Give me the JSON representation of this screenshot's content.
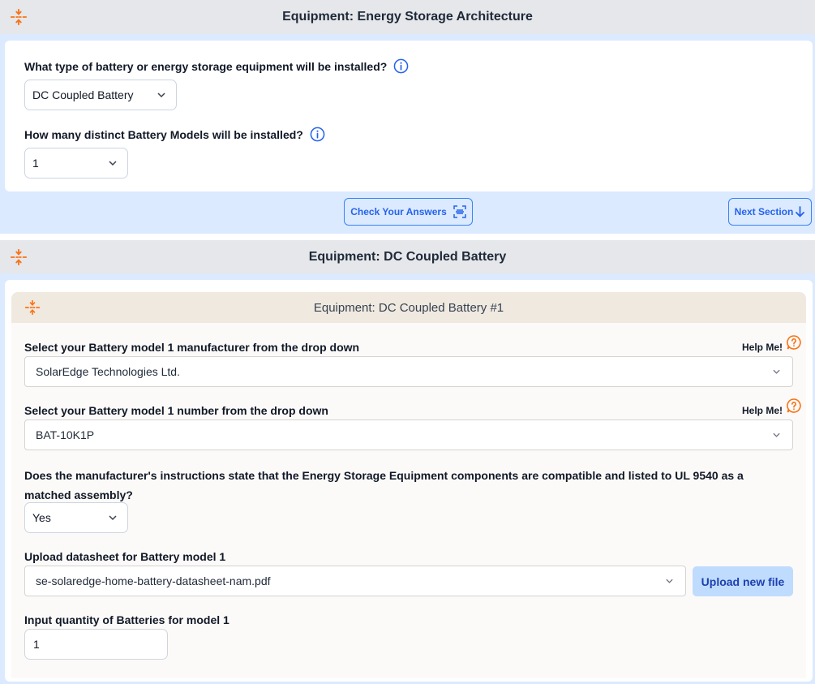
{
  "section1": {
    "title": "Equipment: Energy Storage Architecture",
    "q1": {
      "label": "What type of battery or energy storage equipment will be installed?",
      "value": "DC Coupled Battery"
    },
    "q2": {
      "label": "How many distinct Battery Models will be installed?",
      "value": "1"
    },
    "check_answers_label": "Check Your Answers",
    "next_section_label": "Next Section"
  },
  "section2": {
    "title": "Equipment: DC Coupled Battery",
    "sub": {
      "title": "Equipment: DC Coupled Battery #1",
      "manufacturer": {
        "label": "Select your Battery model 1 manufacturer from the drop down",
        "value": "SolarEdge Technologies Ltd.",
        "help": "Help Me!"
      },
      "model": {
        "label": "Select your Battery model 1 number from the drop down",
        "value": "BAT-10K1P",
        "help": "Help Me!"
      },
      "ul9540": {
        "label": "Does the manufacturer's instructions state that the Energy Storage Equipment components are compatible and listed to UL 9540 as a matched assembly?",
        "value": "Yes"
      },
      "datasheet": {
        "label": "Upload datasheet for Battery model 1",
        "value": "se-solaredge-home-battery-datasheet-nam.pdf",
        "upload_label": "Upload new file"
      },
      "quantity": {
        "label": "Input quantity of Batteries for model 1",
        "value": "1"
      }
    }
  },
  "colors": {
    "accent": "#f97316",
    "link_blue": "#2563eb",
    "band_blue": "#dbeafe",
    "header_gray": "#e5e7eb",
    "sub_header": "#efe9e0"
  }
}
